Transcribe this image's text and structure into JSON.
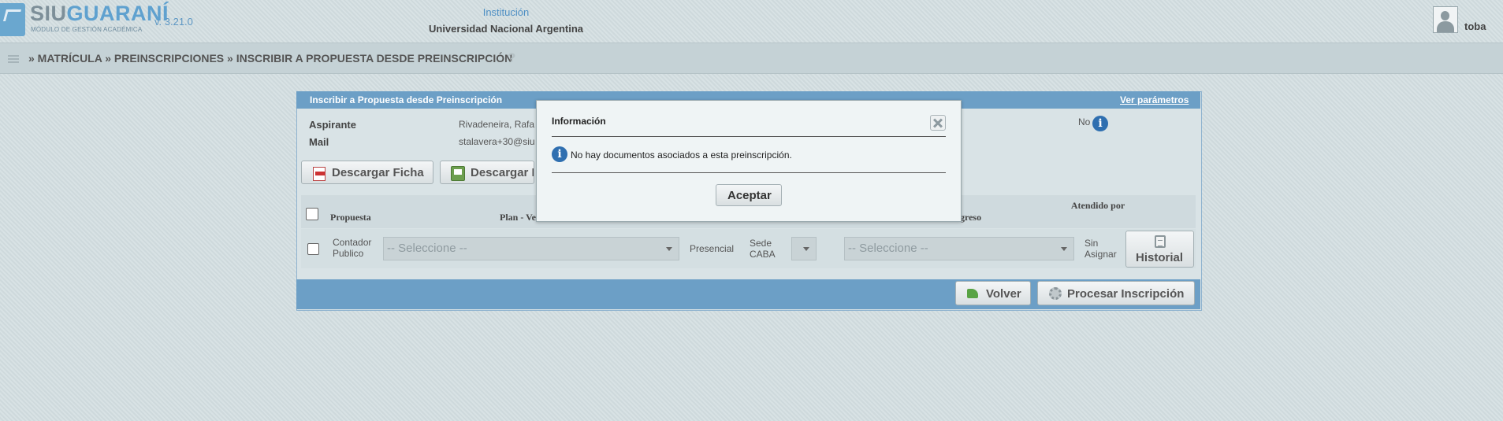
{
  "header": {
    "logo_main_a": "SIU",
    "logo_main_b": "GUARANÍ",
    "logo_sub": "MÓDULO DE GESTIÓN ACADÉMICA",
    "version": "v. 3.21.0",
    "institution_label": "Institución",
    "institution_name": "Universidad Nacional Argentina",
    "username": "toba"
  },
  "breadcrumb": {
    "text": "» MATRÍCULA » PREINSCRIPCIONES »  INSCRIBIR A PROPUESTA DESDE PREINSCRIPCIÓN",
    "help": "?"
  },
  "panel": {
    "title": "Inscribir a Propuesta desde Preinscripción",
    "params_link": "Ver parámetros",
    "fields": {
      "aspirante_label": "Aspirante",
      "aspirante_value": "Rivadeneira, Rafa",
      "mail_label": "Mail",
      "mail_value": "stalavera+30@siu",
      "no_value": "No"
    },
    "buttons": {
      "descargar_ficha": "Descargar Ficha",
      "descargar_f": "Descargar F"
    },
    "table": {
      "headers": {
        "propuesta": "Propuesta",
        "plan": "Plan - Ve",
        "ingreso": "greso",
        "atendido": "Atendido por"
      },
      "row": {
        "propuesta": "Contador Publico",
        "plan_select": "-- Seleccione --",
        "modalidad": "Presencial",
        "sede": "Sede CABA",
        "ingreso_select": "-- Seleccione --",
        "atendido": "Sin Asignar",
        "historial": "Historial"
      }
    },
    "footer": {
      "volver": "Volver",
      "procesar": "Procesar Inscripción"
    }
  },
  "modal": {
    "title": "Información",
    "message": "No hay documentos asociados a esta preinscripción.",
    "accept": "Aceptar"
  },
  "icons": {
    "info": "i"
  }
}
